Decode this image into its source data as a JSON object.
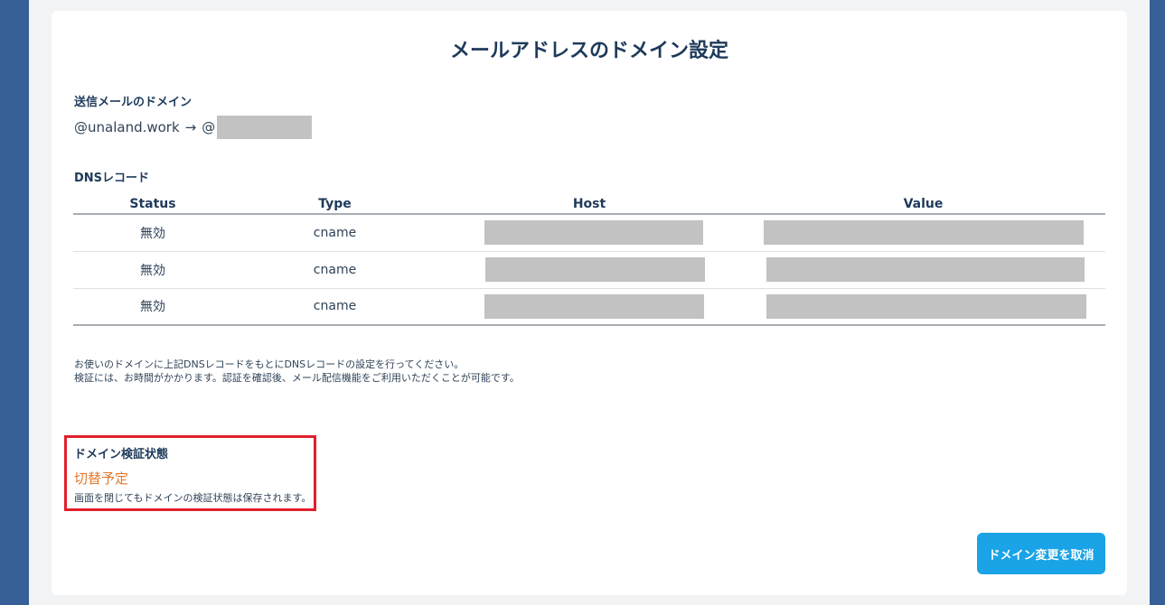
{
  "page": {
    "title": "メールアドレスのドメイン設定"
  },
  "sender": {
    "label": "送信メールのドメイン",
    "from_domain": "@unaland.work",
    "arrow": "→",
    "to_prefix": "@"
  },
  "dns": {
    "label": "DNSレコード",
    "columns": [
      "Status",
      "Type",
      "Host",
      "Value"
    ],
    "rows": [
      {
        "status": "無効",
        "type": "cname"
      },
      {
        "status": "無効",
        "type": "cname"
      },
      {
        "status": "無効",
        "type": "cname"
      }
    ]
  },
  "notes": {
    "line1": "お使いのドメインに上記DNSレコードをもとにDNSレコードの設定を行ってください。",
    "line2": "検証には、お時間がかかります。認証を確認後、メール配信機能をご利用いただくことが可能です。"
  },
  "verification": {
    "label": "ドメイン検証状態",
    "status": "切替予定",
    "note": "画面を閉じてもドメインの検証状態は保存されます。"
  },
  "actions": {
    "cancel_label": "ドメイン変更を取消"
  },
  "colors": {
    "background": "#365f98",
    "status_pending": "#e2782d",
    "button": "#1aa3e6",
    "highlight_border": "#e0202a",
    "redaction": "#c2c2c2"
  }
}
